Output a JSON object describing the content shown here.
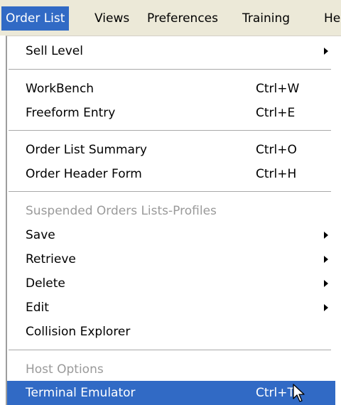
{
  "menubar": {
    "items": [
      {
        "label": "Order List",
        "active": true
      },
      {
        "label": "Views"
      },
      {
        "label": "Preferences"
      },
      {
        "label": "Training"
      },
      {
        "label": "He"
      }
    ]
  },
  "menu": {
    "sell_level": "Sell Level",
    "workbench": {
      "label": "WorkBench",
      "shortcut": "Ctrl+W"
    },
    "freeform": {
      "label": "Freeform Entry",
      "shortcut": "Ctrl+E"
    },
    "summary": {
      "label": "Order List Summary",
      "shortcut": "Ctrl+O"
    },
    "header_form": {
      "label": "Order Header Form",
      "shortcut": "Ctrl+H"
    },
    "suspended_heading": "Suspended Orders Lists-Profiles",
    "save": "Save",
    "retrieve": "Retrieve",
    "delete": "Delete",
    "edit": "Edit",
    "collision": "Collision Explorer",
    "host_heading": "Host Options",
    "terminal": {
      "label": "Terminal Emulator",
      "shortcut": "Ctrl+T"
    }
  },
  "colors": {
    "highlight": "#316ac5",
    "menubar_bg": "#ece9d8",
    "disabled_text": "#9a9a9a"
  },
  "icons": {
    "submenu": "submenu-arrow-icon",
    "pointer": "mouse-pointer-icon"
  }
}
